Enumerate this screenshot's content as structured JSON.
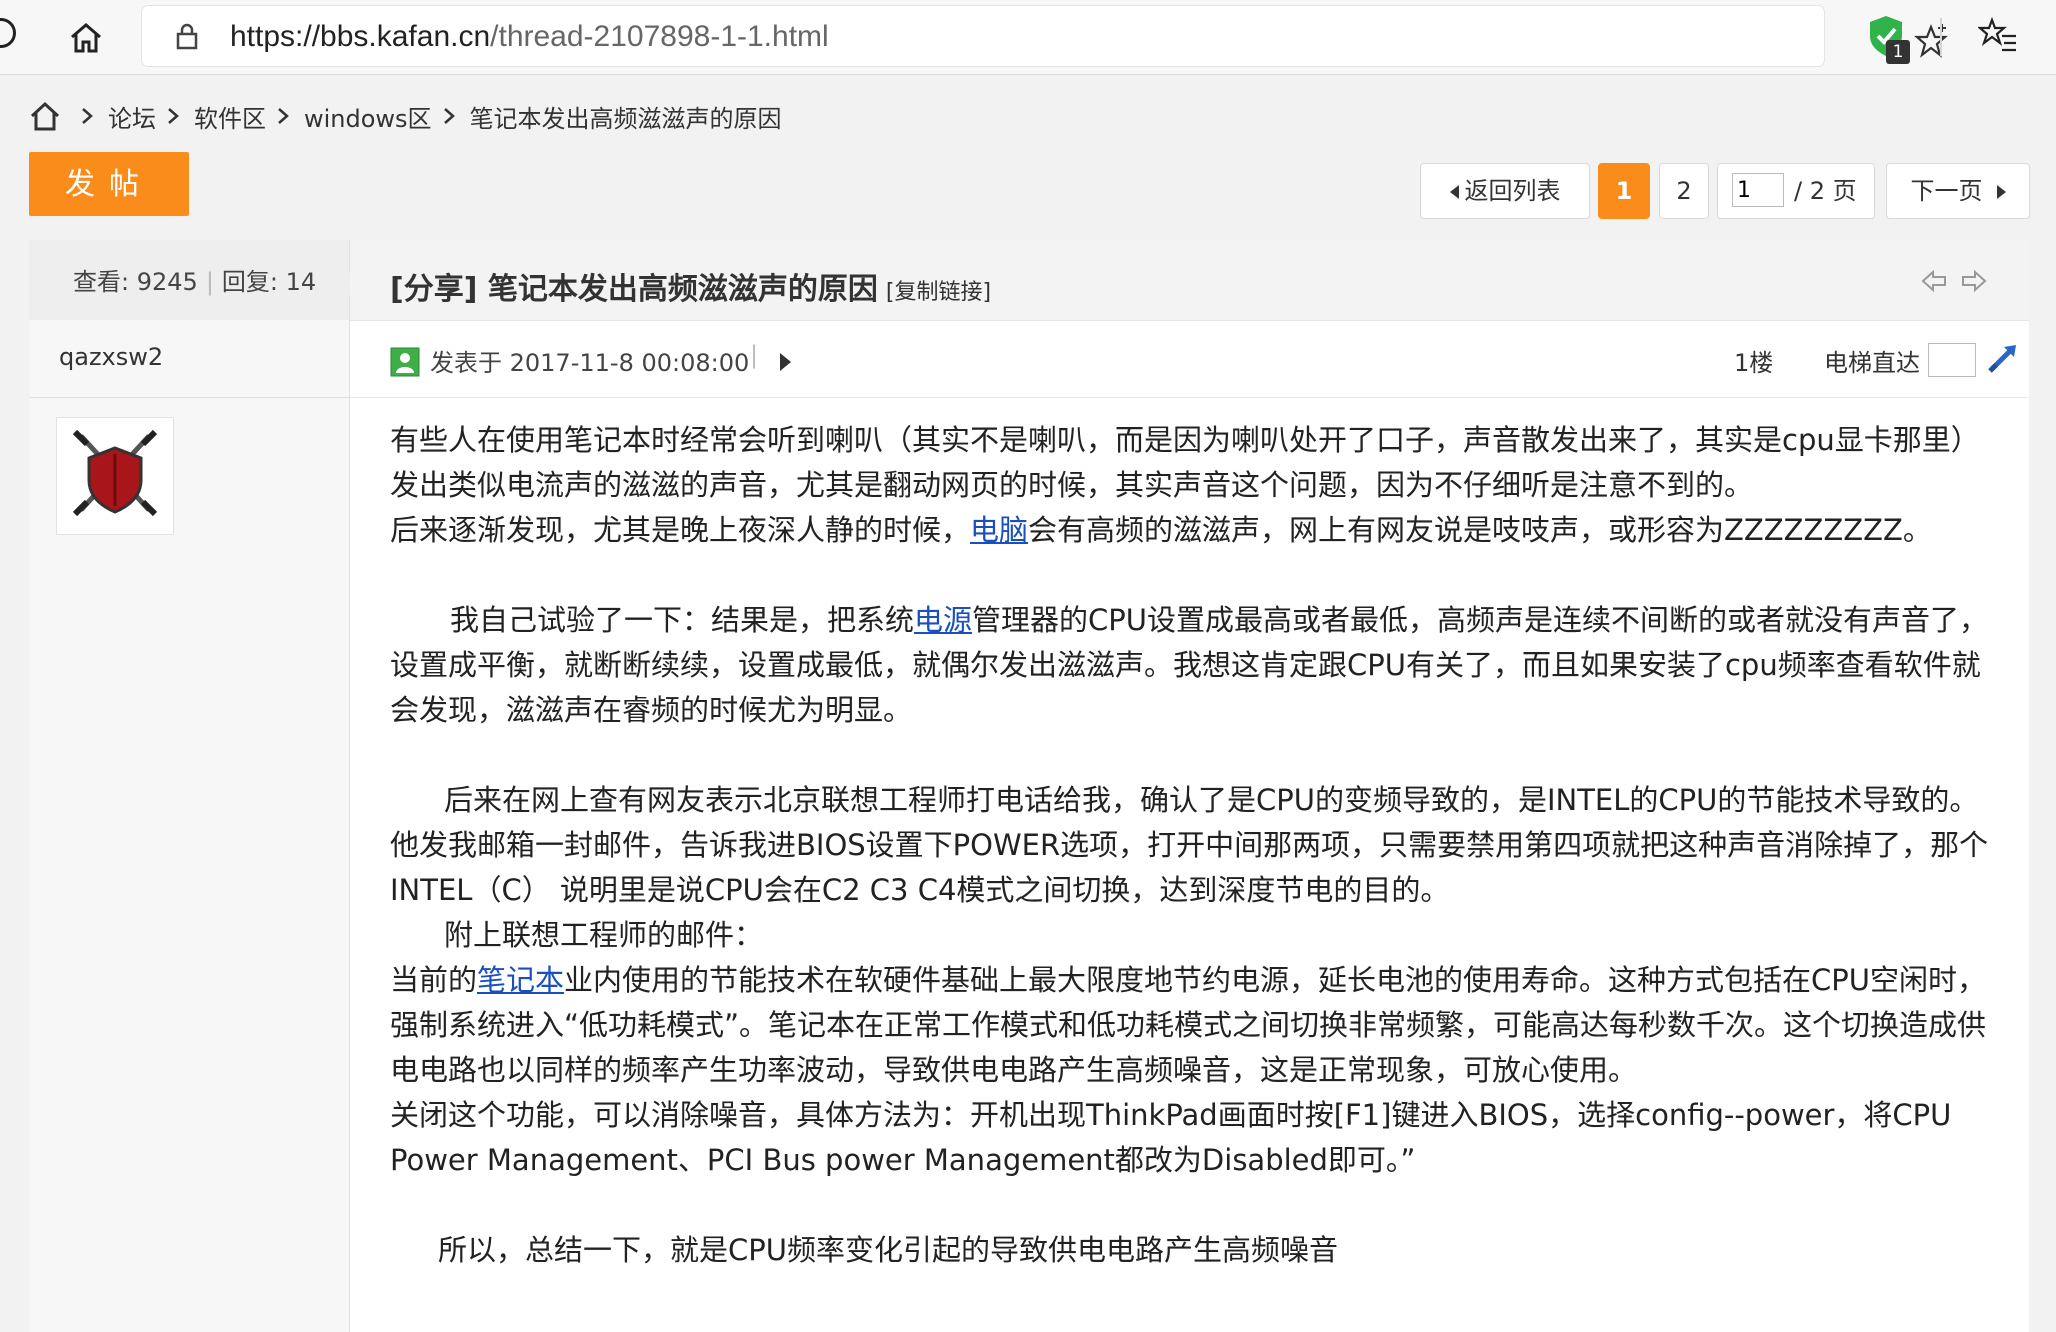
{
  "browser": {
    "url_host": "https://bbs.kafan.cn",
    "url_path": "/thread-2107898-1-1.html",
    "shield_badge": "1"
  },
  "breadcrumb": [
    "论坛",
    "软件区",
    "windows区",
    "笔记本发出高频滋滋声的原因"
  ],
  "post_button": "发帖",
  "pagination": {
    "back": "返回列表",
    "page1": "1",
    "page2": "2",
    "input_value": "1",
    "total": "/ 2 页",
    "next": "下一页"
  },
  "stats": {
    "views_label": "查看:",
    "views": "9245",
    "replies_label": "回复:",
    "replies": "14"
  },
  "thread": {
    "title": "[分享] 笔记本发出高频滋滋声的原因",
    "copy_link": "[复制链接]"
  },
  "post": {
    "author": "qazxsw2",
    "posted": "发表于 2017-11-8 00:08:00",
    "meta_sep": "|",
    "floor": "1楼",
    "elevator": "电梯直达"
  },
  "content": {
    "p1": "有些人在使用笔记本时经常会听到喇叭（其实不是喇叭，而是因为喇叭处开了口子，声音散发出来了，其实是cpu显卡那里）发出类似电流声的滋滋的声音，尤其是翻动网页的时候，其实声音这个问题，因为不仔细听是注意不到的。",
    "p2a": "后来逐渐发现，尤其是晚上夜深人静的时候，",
    "p2_link": "电脑",
    "p2b": "会有高频的滋滋声，网上有网友说是吱吱声，或形容为ZZZZZZZZZ。",
    "p3a": "我自己试验了一下：结果是，把系统",
    "p3_link": "电源",
    "p3b": "管理器的CPU设置成最高或者最低，高频声是连续不间断的或者就没有声音了，设置成平衡，就断断续续，设置成最低，就偶尔发出滋滋声。我想这肯定跟CPU有关了，而且如果安装了cpu频率查看软件就会发现，滋滋声在睿频的时候尤为明显。",
    "p4": "后来在网上查有网友表示北京联想工程师打电话给我，确认了是CPU的变频导致的，是INTEL的CPU的节能技术导致的。他发我邮箱一封邮件，告诉我进BIOS设置下POWER选项，打开中间那两项，只需要禁用第四项就把这种声音消除掉了，那个INTEL（C） 说明里是说CPU会在C2 C3 C4模式之间切换，达到深度节电的目的。",
    "p5": "附上联想工程师的邮件：",
    "p6a": "当前的",
    "p6_link": "笔记本",
    "p6b": "业内使用的节能技术在软硬件基础上最大限度地节约电源，延长电池的使用寿命。这种方式包括在CPU空闲时，强制系统进入“低功耗模式”。笔记本在正常工作模式和低功耗模式之间切换非常频繁，可能高达每秒数千次。这个切换造成供电电路也以同样的频率产生功率波动，导致供电电路产生高频噪音，这是正常现象，可放心使用。",
    "p7": "关闭这个功能，可以消除噪音，具体方法为：开机出现ThinkPad画面时按[F1]键进入BIOS，选择config--power，将CPU Power Management、PCI Bus power Management都改为Disabled即可。”",
    "p8": "所以，总结一下，就是CPU频率变化引起的导致供电电路产生高频噪音"
  },
  "colors": {
    "accent": "#f98c1b",
    "link": "#1a4fc0"
  }
}
